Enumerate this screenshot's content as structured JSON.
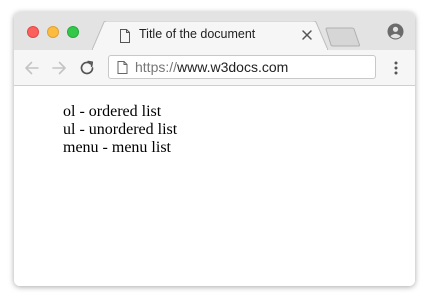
{
  "browser": {
    "tab": {
      "title": "Title of the document",
      "favicon": "document-icon",
      "close_icon": "close-icon"
    },
    "address_bar": {
      "scheme": "https://",
      "host": "www.w3docs.com",
      "page_icon": "page-icon"
    },
    "toolbar_icons": [
      "back-arrow-icon",
      "forward-arrow-icon",
      "reload-icon",
      "more-vert-icon"
    ],
    "window_controls": [
      "close",
      "minimize",
      "zoom"
    ],
    "colors": {
      "close": "#fc605c",
      "minimize": "#fdbc40",
      "zoom": "#34c84a",
      "titlebar": "#e3e3e3",
      "toolbar": "#f6f6f6"
    }
  },
  "page": {
    "lines": [
      "ol - ordered list",
      "ul - unordered list",
      "menu - menu list"
    ]
  }
}
